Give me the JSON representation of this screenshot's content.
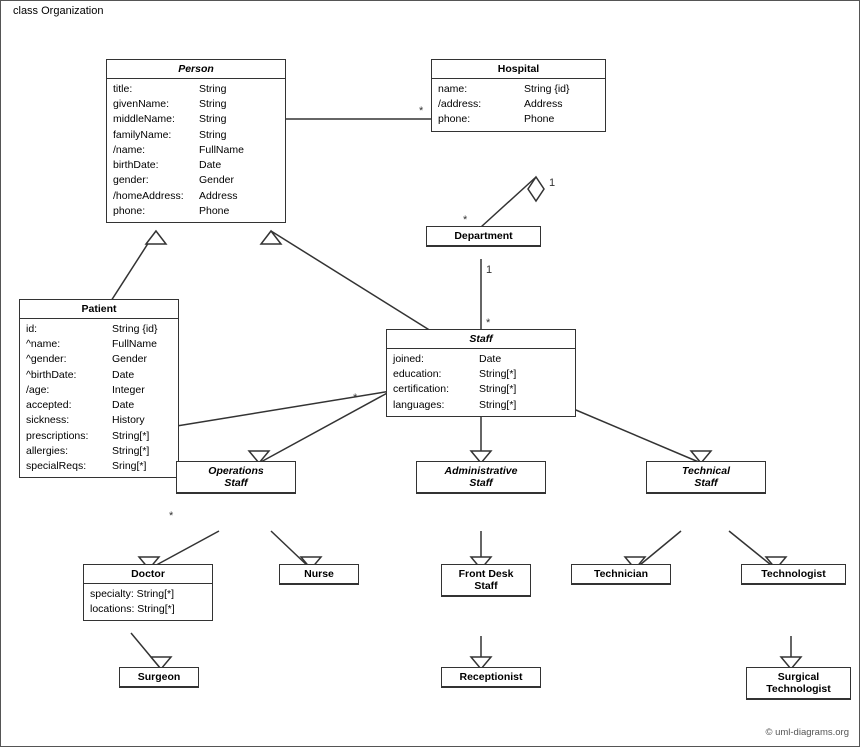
{
  "diagram": {
    "title": "class Organization",
    "copyright": "© uml-diagrams.org",
    "classes": {
      "person": {
        "name": "Person",
        "italic": true,
        "attrs": [
          {
            "name": "title:",
            "type": "String"
          },
          {
            "name": "givenName:",
            "type": "String"
          },
          {
            "name": "middleName:",
            "type": "String"
          },
          {
            "name": "familyName:",
            "type": "String"
          },
          {
            "name": "/name:",
            "type": "FullName"
          },
          {
            "name": "birthDate:",
            "type": "Date"
          },
          {
            "name": "gender:",
            "type": "Gender"
          },
          {
            "name": "/homeAddress:",
            "type": "Address"
          },
          {
            "name": "phone:",
            "type": "Phone"
          }
        ]
      },
      "hospital": {
        "name": "Hospital",
        "italic": false,
        "attrs": [
          {
            "name": "name:",
            "type": "String {id}"
          },
          {
            "name": "/address:",
            "type": "Address"
          },
          {
            "name": "phone:",
            "type": "Phone"
          }
        ]
      },
      "department": {
        "name": "Department",
        "italic": false,
        "attrs": []
      },
      "staff": {
        "name": "Staff",
        "italic": true,
        "attrs": [
          {
            "name": "joined:",
            "type": "Date"
          },
          {
            "name": "education:",
            "type": "String[*]"
          },
          {
            "name": "certification:",
            "type": "String[*]"
          },
          {
            "name": "languages:",
            "type": "String[*]"
          }
        ]
      },
      "patient": {
        "name": "Patient",
        "italic": false,
        "attrs": [
          {
            "name": "id:",
            "type": "String {id}"
          },
          {
            "name": "^name:",
            "type": "FullName"
          },
          {
            "name": "^gender:",
            "type": "Gender"
          },
          {
            "name": "^birthDate:",
            "type": "Date"
          },
          {
            "name": "/age:",
            "type": "Integer"
          },
          {
            "name": "accepted:",
            "type": "Date"
          },
          {
            "name": "sickness:",
            "type": "History"
          },
          {
            "name": "prescriptions:",
            "type": "String[*]"
          },
          {
            "name": "allergies:",
            "type": "String[*]"
          },
          {
            "name": "specialReqs:",
            "type": "Sring[*]"
          }
        ]
      },
      "operations_staff": {
        "name": "Operations Staff",
        "italic": true
      },
      "administrative_staff": {
        "name": "Administrative Staff",
        "italic": true
      },
      "technical_staff": {
        "name": "Technical Staff",
        "italic": true
      },
      "doctor": {
        "name": "Doctor",
        "italic": false,
        "attrs": [
          {
            "name": "specialty:",
            "type": "String[*]"
          },
          {
            "name": "locations:",
            "type": "String[*]"
          }
        ]
      },
      "nurse": {
        "name": "Nurse",
        "italic": false,
        "attrs": []
      },
      "front_desk_staff": {
        "name": "Front Desk Staff",
        "italic": false,
        "attrs": []
      },
      "technician": {
        "name": "Technician",
        "italic": false,
        "attrs": []
      },
      "technologist": {
        "name": "Technologist",
        "italic": false,
        "attrs": []
      },
      "surgeon": {
        "name": "Surgeon",
        "italic": false,
        "attrs": []
      },
      "receptionist": {
        "name": "Receptionist",
        "italic": false,
        "attrs": []
      },
      "surgical_technologist": {
        "name": "Surgical Technologist",
        "italic": false,
        "attrs": []
      }
    }
  }
}
